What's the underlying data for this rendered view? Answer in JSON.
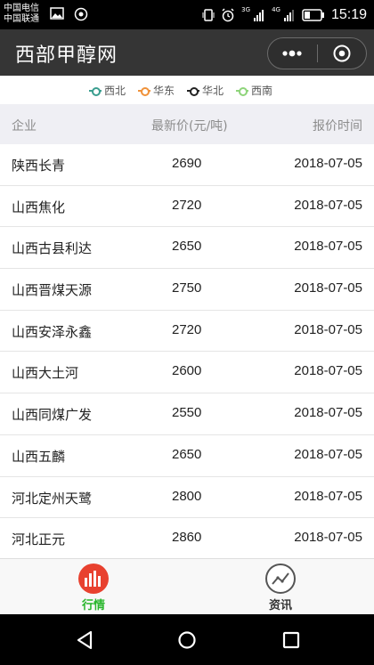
{
  "status_bar": {
    "carrier_1": "中国电信",
    "carrier_2": "中国联通",
    "net_3g": "3G",
    "net_4g": "4G",
    "time": "15:19"
  },
  "title_bar": {
    "title": "西部甲醇网"
  },
  "legend": {
    "items": [
      {
        "label": "西北",
        "color": "#3a9e8f"
      },
      {
        "label": "华东",
        "color": "#f0923a"
      },
      {
        "label": "华北",
        "color": "#222222"
      },
      {
        "label": "西南",
        "color": "#8ed47a"
      }
    ]
  },
  "table": {
    "headers": {
      "company": "企业",
      "price": "最新价(元/吨)",
      "time": "报价时间"
    },
    "rows": [
      {
        "company": "陕西长青",
        "price": "2690",
        "time": "2018-07-05"
      },
      {
        "company": "山西焦化",
        "price": "2720",
        "time": "2018-07-05"
      },
      {
        "company": "山西古县利达",
        "price": "2650",
        "time": "2018-07-05"
      },
      {
        "company": "山西晋煤天源",
        "price": "2750",
        "time": "2018-07-05"
      },
      {
        "company": "山西安泽永鑫",
        "price": "2720",
        "time": "2018-07-05"
      },
      {
        "company": "山西大土河",
        "price": "2600",
        "time": "2018-07-05"
      },
      {
        "company": "山西同煤广发",
        "price": "2550",
        "time": "2018-07-05"
      },
      {
        "company": "山西五麟",
        "price": "2650",
        "time": "2018-07-05"
      },
      {
        "company": "河北定州天鹭",
        "price": "2800",
        "time": "2018-07-05"
      },
      {
        "company": "河北正元",
        "price": "2860",
        "time": "2018-07-05"
      }
    ]
  },
  "tab_bar": {
    "market_label": "行情",
    "news_label": "资讯",
    "active_color": "#28b62c"
  }
}
